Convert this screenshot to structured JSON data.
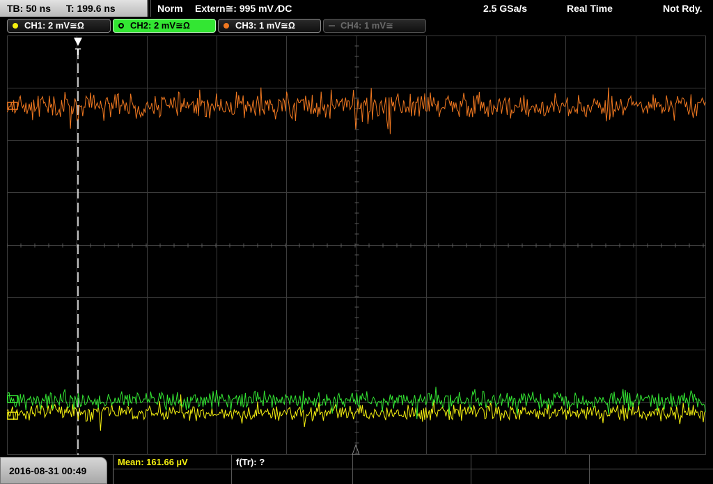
{
  "topbar": {
    "timebase": "TB: 50 ns",
    "trigger_time": "T: 199.6 ns",
    "trigger_mode": "Norm",
    "trigger_source": "Extern≅: 995 mV ∕DC",
    "sample_rate": "2.5 GSa/s",
    "acq_mode": "Real Time",
    "status": "Not Rdy."
  },
  "channels": [
    {
      "label": "CH1: 2 mV≅Ω",
      "color": "#f5f010",
      "state": "on"
    },
    {
      "label": "CH2: 2 mV≅Ω",
      "color": "#33e633",
      "state": "active"
    },
    {
      "label": "CH3: 1 mV≅Ω",
      "color": "#f07820",
      "state": "on"
    },
    {
      "label": "CH4: 1 mV≅",
      "color": "#555555",
      "state": "off"
    }
  ],
  "screen": {
    "trigger_marker": "T",
    "grid_color": "#3c3c3c",
    "trace_colors": {
      "ch1": "#f5f010",
      "ch2": "#33e633",
      "ch3": "#f07820"
    }
  },
  "footer": {
    "datetime": "2016-08-31 00:49",
    "measurements": [
      {
        "label": "Mean: 161.66 µV",
        "color": "#f5f010"
      },
      {
        "label": "f(Tr): ?",
        "color": "#ffffff"
      }
    ]
  }
}
